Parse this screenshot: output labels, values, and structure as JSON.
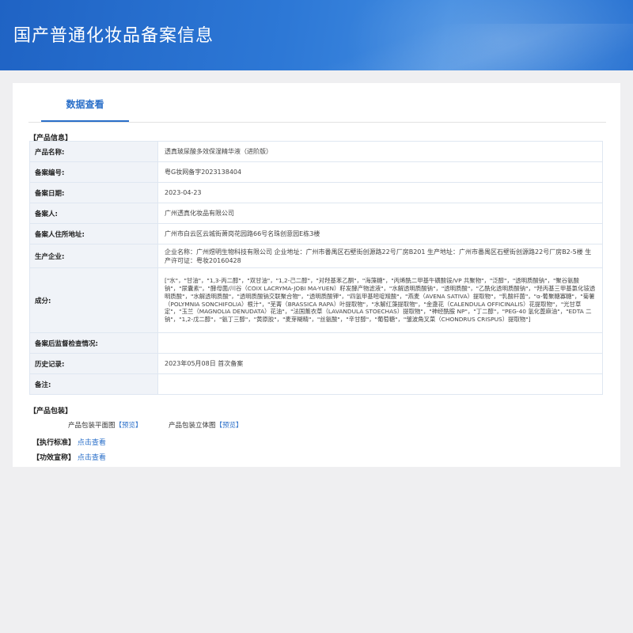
{
  "header": {
    "title": "国产普通化妆品备案信息"
  },
  "tab": {
    "label": "数据查看"
  },
  "product_info": {
    "section_label": "【产品信息】",
    "rows": [
      {
        "key": "产品名称:",
        "value": "透真玻尿酸多效保湿精华液（进阶版）"
      },
      {
        "key": "备案编号:",
        "value": "粤G妆网备字2023138404"
      },
      {
        "key": "备案日期:",
        "value": "2023-04-23"
      },
      {
        "key": "备案人:",
        "value": "广州透真化妆品有限公司"
      },
      {
        "key": "备案人住所地址:",
        "value": "广州市白云区云城街萧岗花园路66号名珠创意园E栋3楼"
      },
      {
        "key": "生产企业:",
        "value": "企业名称：广州煜明生物科技有限公司 企业地址：广州市番禺区石壁街创源路22号厂房B201 生产地址：广州市番禺区石壁街创源路22号厂房B2-5楼 生产许可证：粤妆20160428"
      },
      {
        "key": "成分:",
        "value": "[\"水\"，\"甘油\"，\"1,3-丙二醇\"，\"双甘油\"，\"1,2-己二醇\"，\"对羟基苯乙酮\"，\"海藻糖\"，\"丙烯酰二甲基牛磺酸铵/VP 共聚物\"，\"泛醇\"，\"透明质酸钠\"，\"聚谷氨酸钠\"，\"尿囊素\"，\"酵母菌/川谷（COIX LACRYMA-JOBI MA-YUEN）籽发酵产物滤液\"，\"水解透明质酸钠\"，\"透明质酸\"，\"乙酰化透明质酸钠\"，\"羟丙基三甲基氯化铵透明质酸\"，\"水解透明质酸\"，\"透明质酸钠交联聚合物\"，\"透明质酸钾\"，\"四氢甲基嘧啶羧酸\"，\"燕麦（AVENA SATIVA）提取物\"，\"乳酸杆菌\"，\"α-葡聚糖寡糖\"，\"菊薯（POLYMNIA SONCHIFOLIA）根汁\"，\"芜菁（BRASSICA RAPA）叶提取物\"，\"水解红藻提取物\"，\"金盏花（CALENDULA OFFICINALIS）花提取物\"，\"光甘草定\"，\"玉兰（MAGNOLIA DENUDATA）花油\"，\"法国薰衣草（LAVANDULA STOECHAS）提取物\"，\"神经酰胺 NP\"，\"丁二醇\"，\"PEG-40 氢化蓖麻油\"，\"EDTA 二钠\"，\"1,2-戊二醇\"，\"氨丁三醇\"，\"黄原胶\"，\"麦芽糊精\"，\"丝氨酸\"，\"辛甘醇\"，\"葡萄糖\"，\"皱波角叉菜（CHONDRUS CRISPUS）提取物\"]"
      },
      {
        "key": "备案后监督检查情况:",
        "value": ""
      },
      {
        "key": "历史记录:",
        "value": "2023年05月08日 首次备案"
      },
      {
        "key": "备注:",
        "value": ""
      }
    ]
  },
  "packaging": {
    "section_label": "【产品包装】",
    "flat_label": "产品包装平面图",
    "flat_link": "【预览】",
    "solid_label": "产品包装立体图",
    "solid_link": "【预览】"
  },
  "standard": {
    "label": "【执行标准】",
    "link": "点击查看"
  },
  "efficacy": {
    "label": "【功效宣称】",
    "link": "点击查看"
  }
}
